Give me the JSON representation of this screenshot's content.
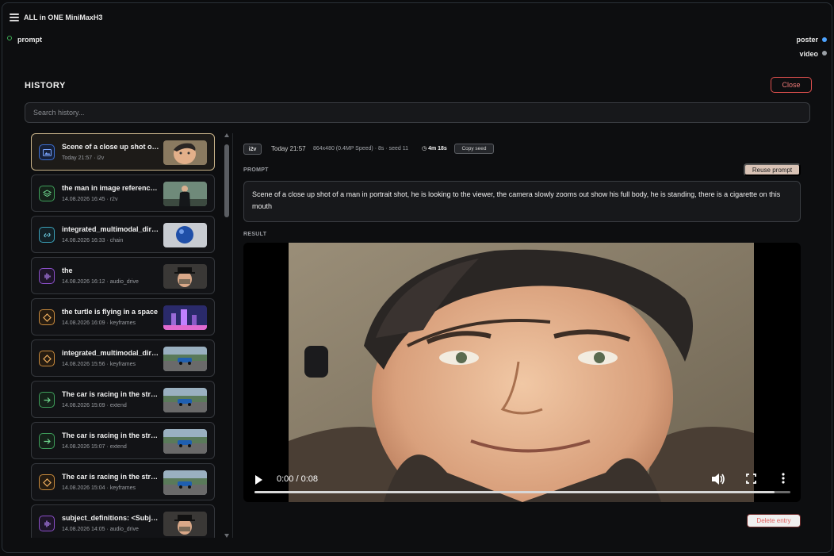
{
  "app": {
    "title": "ALL in ONE MiniMaxH3"
  },
  "node": {
    "input_label": "prompt",
    "outputs": [
      "poster",
      "video"
    ],
    "colors": {
      "input": "#3fae56",
      "poster": "#4da3ff",
      "video": "#9aa0a6"
    }
  },
  "history": {
    "title": "HISTORY",
    "close_label": "Close",
    "search_placeholder": "Search history...",
    "items": [
      {
        "title": "Scene of a close up shot of a man in portrait shot",
        "meta": "Today 21:57 · i2v",
        "icon": "image-icon",
        "color": "blue",
        "selected": true,
        "thumb": "face"
      },
      {
        "title": "the man in image reference walks",
        "meta": "14.08.2026 16:45 · r2v",
        "icon": "layers-icon",
        "color": "green",
        "selected": false,
        "thumb": "suit"
      },
      {
        "title": "integrated_multimodal_director",
        "meta": "14.08.2026 16:33 · chain",
        "icon": "link-icon",
        "color": "cyan",
        "selected": false,
        "thumb": "sphere"
      },
      {
        "title": "the",
        "meta": "14.08.2026 16:12 · audio_drive",
        "icon": "waveform-icon",
        "color": "purple",
        "selected": false,
        "thumb": "hat"
      },
      {
        "title": "the turtle is flying in a space",
        "meta": "14.08.2026 16:09 · keyframes",
        "icon": "diamond-icon",
        "color": "orange",
        "selected": false,
        "thumb": "castle"
      },
      {
        "title": "integrated_multimodal_director",
        "meta": "14.08.2026 15:56 · keyframes",
        "icon": "diamond-icon",
        "color": "orange",
        "selected": false,
        "thumb": "car"
      },
      {
        "title": "The car is racing in the street",
        "meta": "14.08.2026 15:09 · extend",
        "icon": "arrow-right-icon",
        "color": "green",
        "selected": false,
        "thumb": "car"
      },
      {
        "title": "The car is racing in the street",
        "meta": "14.08.2026 15:07 · extend",
        "icon": "arrow-right-icon",
        "color": "green",
        "selected": false,
        "thumb": "car"
      },
      {
        "title": "The car is racing in the street",
        "meta": "14.08.2026 15:04 · keyframes",
        "icon": "diamond-icon",
        "color": "orange",
        "selected": false,
        "thumb": "car"
      },
      {
        "title": "subject_definitions: <Subject>",
        "meta": "14.08.2026 14:05 · audio_drive",
        "icon": "waveform-icon",
        "color": "purple",
        "selected": false,
        "thumb": "hat"
      }
    ]
  },
  "detail": {
    "badge": "i2v",
    "time": "Today 21:57",
    "spec": "864x480 (0.4MP Speed) · 8s · seed 11",
    "duration": "4m 18s",
    "copy_seed_label": "Copy seed",
    "prompt_label": "PROMPT",
    "reuse_label": "Reuse prompt",
    "prompt_text": "Scene of a close up shot of a man in portrait shot, he is looking to the viewer, the camera slowly zooms out show his full body, he is standing, there is a cigarette on this mouth",
    "result_label": "RESULT",
    "video_time": "0:00 / 0:08",
    "video_progress": 0.97,
    "delete_label": "Delete entry"
  }
}
